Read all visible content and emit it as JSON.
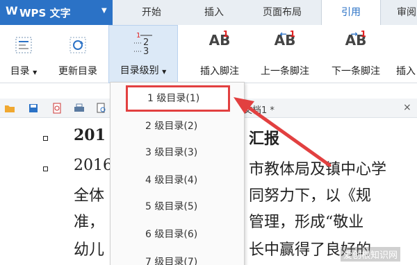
{
  "app": {
    "logo": "W",
    "title": "WPS 文字"
  },
  "tabs": [
    {
      "label": "开始"
    },
    {
      "label": "插入"
    },
    {
      "label": "页面布局"
    },
    {
      "label": "引用"
    },
    {
      "label": "审阅"
    }
  ],
  "ribbon": {
    "toc": "目录",
    "update_toc": "更新目录",
    "toc_level": "目录级别",
    "insert_footnote": "插入脚注",
    "prev_footnote": "上一条脚注",
    "next_footnote": "下一条脚注",
    "insert_partial": "插入",
    "ab_text": "AB",
    "superscript_one": "1"
  },
  "toc_icon": {
    "number_one": "1",
    "number_two": "2",
    "number_three": "3"
  },
  "toolbar2": {
    "doc_tab": "文档1 *",
    "close": "×"
  },
  "dropdown": {
    "items": [
      {
        "label": "1 级目录(1)"
      },
      {
        "label": "2 级目录(2)"
      },
      {
        "label": "3 级目录(3)"
      },
      {
        "label": "4 级目录(4)"
      },
      {
        "label": "5 级目录(5)"
      },
      {
        "label": "6 级目录(6)"
      },
      {
        "label": "7 级目录(7)"
      }
    ]
  },
  "document": {
    "heading_left": "201",
    "heading_right": "汇报",
    "para_left": "2016",
    "para_right": "市教体局及镇中心学",
    "line2_left": "全体",
    "line2_right": "同努力下，以《规",
    "line3_left": "准，",
    "line3_right": "管理，形成“敬业",
    "line4_left": "幼儿",
    "line4_right": "长中赢得了良好的"
  },
  "watermark": "爱创根知识网",
  "colors": {
    "accent": "#2b72c6",
    "highlight": "#e24040"
  }
}
